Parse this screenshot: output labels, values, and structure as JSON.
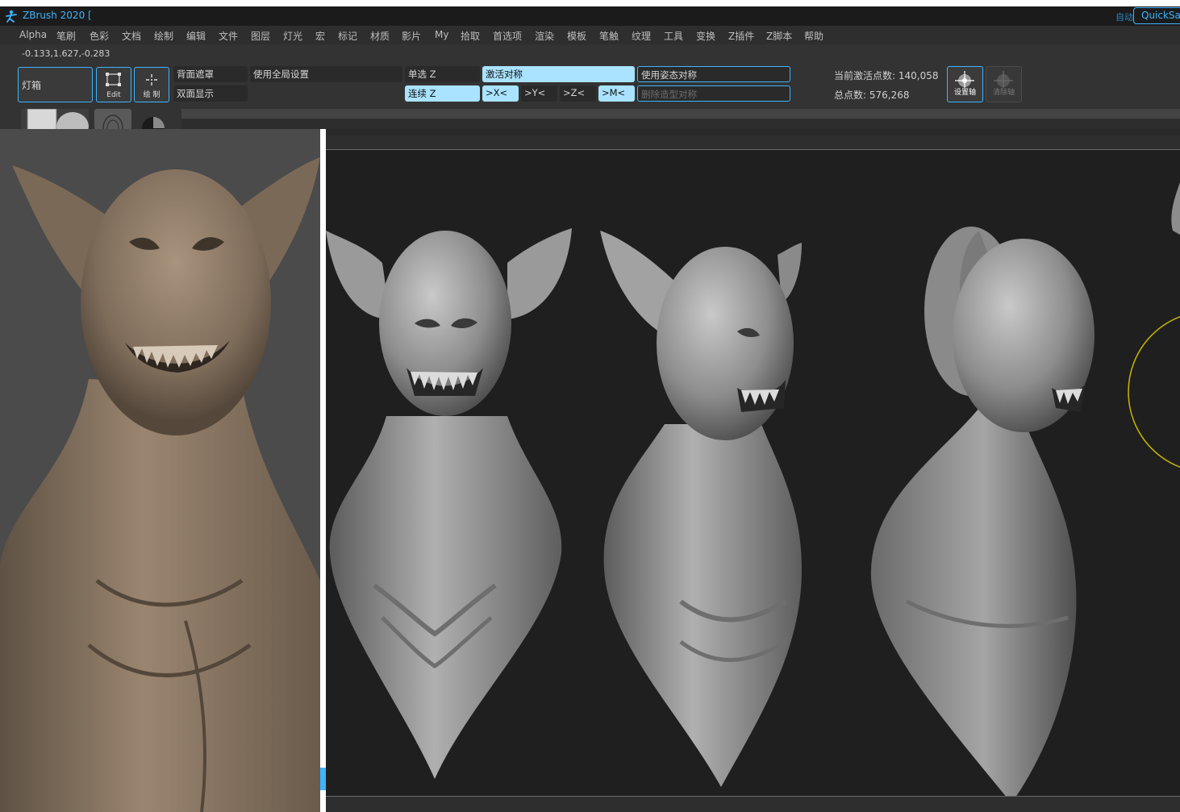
{
  "titlebar": {
    "app_title": "ZBrush 2020 [",
    "auto_label": "自动",
    "quicksave_label": "QuickSave"
  },
  "menu": [
    "Alpha",
    "笔刷",
    "色彩",
    "文档",
    "绘制",
    "编辑",
    "文件",
    "图层",
    "灯光",
    "宏",
    "标记",
    "材质",
    "影片",
    "My",
    "拾取",
    "首选项",
    "渲染",
    "模板",
    "笔触",
    "纹理",
    "工具",
    "变换",
    "Z插件",
    "Z脚本",
    "帮助"
  ],
  "toolbar": {
    "coords": "-0.133,1.627,-0.283",
    "lightbox_label": "灯箱",
    "edit_label": "Edit",
    "draw_label": "绘 制",
    "backface_mask": "背面遮罩",
    "double_sided": "双面显示",
    "use_global": "使用全局设置",
    "single_z": "单选 Z",
    "continuous_z": "连续 Z",
    "activate_symmetry": "激活对称",
    "x_axis": ">X<",
    "y_axis": ">Y<",
    "z_axis": ">Z<",
    "m_axis": ">M<",
    "use_posable_symmetry": "使用姿态对称",
    "delete_posable_symmetry": "删除造型对称",
    "active_points": "当前激活点数: 140,058",
    "total_points": "总点数: 576,268",
    "set_axis_label": "设置轴",
    "clear_axis_label": "清除轴"
  },
  "colors": {
    "accent": "#3fb4ff",
    "active_field": "#a9e3ff",
    "background": "#2b2b2b",
    "canvas": "#1f1f1f",
    "reference_clay": "#8c7a66",
    "model_gray": "#8a8a8a",
    "gizmo": "#c8b400"
  },
  "icons": {
    "logo": "zbrush-logo-icon",
    "edit": "edit-mode-icon",
    "draw": "draw-mode-icon",
    "set_axis": "set-axis-icon",
    "clear_axis": "clear-axis-icon"
  }
}
